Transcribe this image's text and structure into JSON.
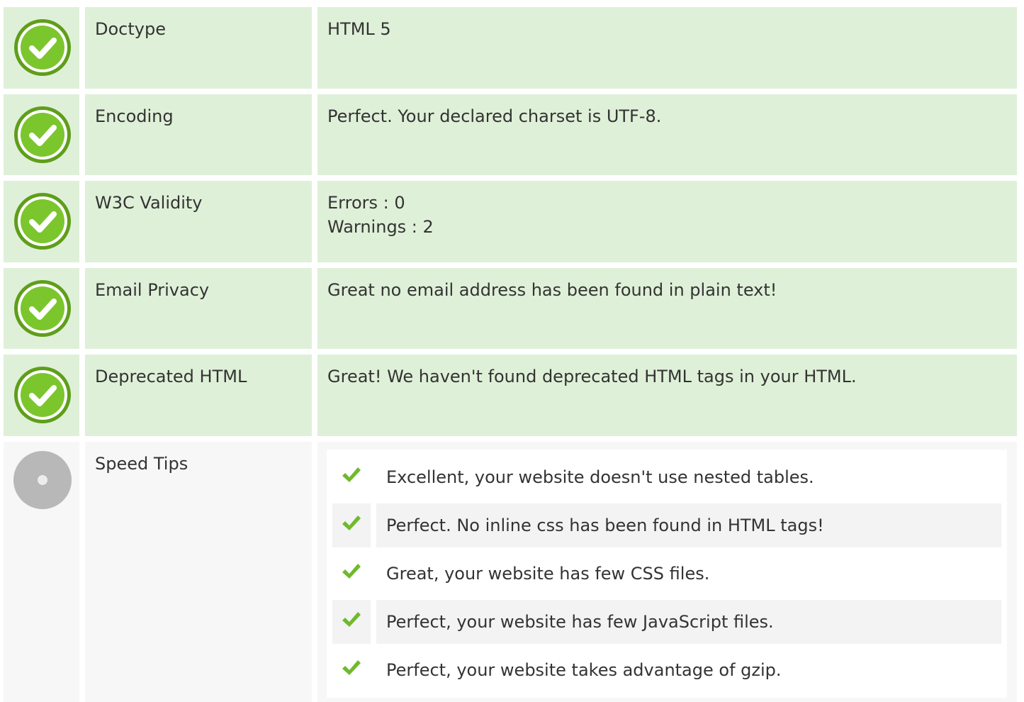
{
  "rows": [
    {
      "label": "Doctype",
      "value": "HTML 5",
      "status": "pass"
    },
    {
      "label": "Encoding",
      "value": "Perfect. Your declared charset is UTF-8.",
      "status": "pass"
    },
    {
      "label": "W3C Validity",
      "value_lines": [
        "Errors : 0",
        "Warnings : 2"
      ],
      "status": "pass"
    },
    {
      "label": "Email Privacy",
      "value": "Great no email address has been found in plain text!",
      "status": "pass"
    },
    {
      "label": "Deprecated HTML",
      "value": "Great! We haven't found deprecated HTML tags in your HTML.",
      "status": "pass"
    }
  ],
  "speed_tips": {
    "label": "Speed Tips",
    "status": "neutral",
    "items": [
      "Excellent, your website doesn't use nested tables.",
      "Perfect. No inline css has been found in HTML tags!",
      "Great, your website has few CSS files.",
      "Perfect, your website has few JavaScript files.",
      "Perfect, your website takes advantage of gzip."
    ]
  },
  "colors": {
    "pass_background": "#dff0d8",
    "neutral_background": "#f7f7f7",
    "check_green": "#7bc62d",
    "tick_green": "#6fba2c"
  },
  "icons": {
    "pass": "check-circle-icon",
    "neutral": "grey-circle-icon",
    "tip": "checkmark-icon"
  }
}
